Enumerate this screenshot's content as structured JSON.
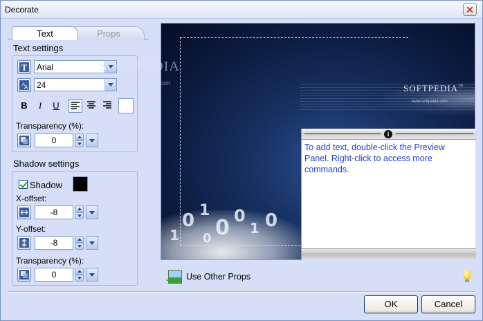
{
  "window": {
    "title": "Decorate",
    "close_glyph": "✕"
  },
  "tabs": [
    {
      "label": "Text",
      "selected": true
    },
    {
      "label": "Props",
      "selected": false
    }
  ],
  "text_settings": {
    "heading": "Text settings",
    "font": {
      "value": "Arial",
      "icon": "font-icon"
    },
    "size": {
      "value": "24",
      "icon": "font-size-icon"
    },
    "format_buttons": [
      {
        "glyph": "B",
        "name": "bold"
      },
      {
        "glyph": "I",
        "name": "italic"
      },
      {
        "glyph": "U",
        "name": "underline"
      }
    ],
    "align_buttons": [
      {
        "name": "align-left",
        "active": true
      },
      {
        "name": "align-center",
        "active": false
      },
      {
        "name": "align-right",
        "active": false
      }
    ],
    "text_color": "#ffffff",
    "transparency_label": "Transparency (%):",
    "transparency_value": "0"
  },
  "shadow_settings": {
    "heading": "Shadow settings",
    "shadow_checkbox_label": "Shadow",
    "shadow_checked": true,
    "shadow_color": "#000000",
    "x_offset_label": "X-offset:",
    "x_offset_value": "-8",
    "y_offset_label": "Y-offset:",
    "y_offset_value": "-8",
    "transparency_label": "Transparency (%):",
    "transparency_value": "0"
  },
  "preview": {
    "watermark": "SOFTPEDIA",
    "watermark_url": "www.softpedia.com",
    "brand": "SOFTPEDIA",
    "brand_mark": "™",
    "brand_url": "www.softpedia.com",
    "info_text": "To add text, double-click the Preview Panel. Right-click to access more commands.",
    "info_glyph": "i"
  },
  "use_other_props_label": "Use Other Props",
  "buttons": {
    "ok": "OK",
    "cancel": "Cancel"
  },
  "colors": {
    "link_blue": "#1f3fd0",
    "window_bg": "#d6dff7"
  }
}
